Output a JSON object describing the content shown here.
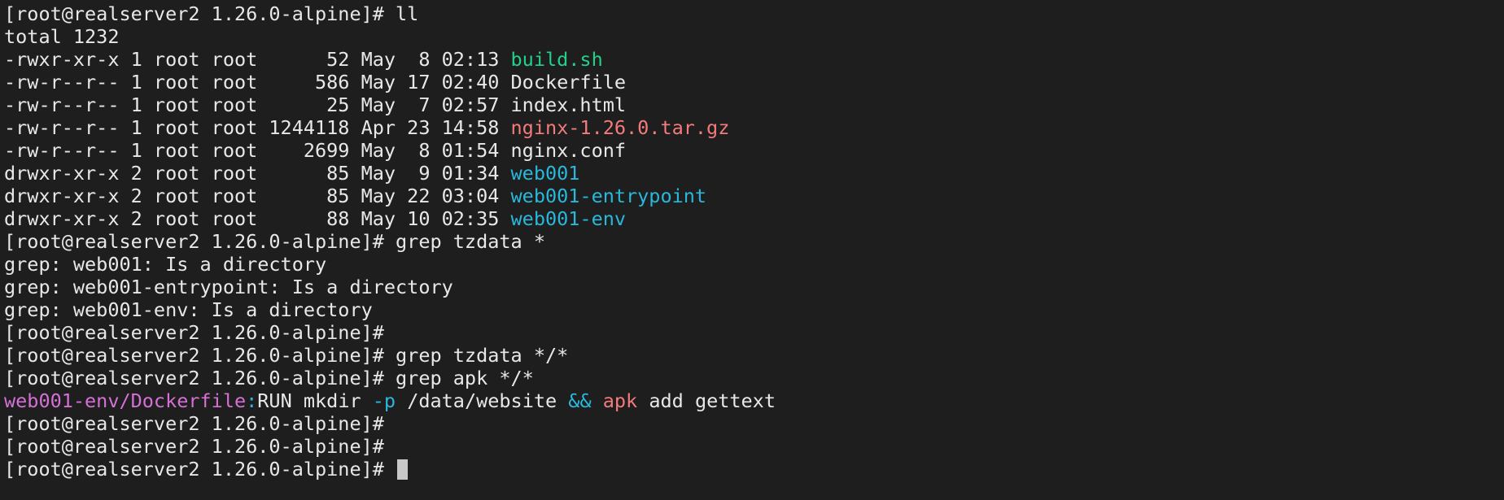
{
  "colors": {
    "background": "#1e1e1e",
    "default_text": "#e8e8e8",
    "executable": "#23d18b",
    "archive": "#f47b7b",
    "directory": "#29b8db",
    "grep_filename": "#d670d6",
    "grep_separator": "#29b8db",
    "highlight_operator": "#29b8db",
    "highlight_command": "#f47b7b"
  },
  "prompt": "[root@realserver2 1.26.0-alpine]#",
  "lines": [
    {
      "segments": [
        {
          "text": "[root@realserver2 1.26.0-alpine]# ll",
          "color": "default_text"
        }
      ]
    },
    {
      "segments": [
        {
          "text": "total 1232",
          "color": "default_text"
        }
      ]
    },
    {
      "segments": [
        {
          "text": "-rwxr-xr-x 1 root root      52 May  8 02:13 ",
          "color": "default_text"
        },
        {
          "text": "build.sh",
          "color": "executable"
        }
      ]
    },
    {
      "segments": [
        {
          "text": "-rw-r--r-- 1 root root     586 May 17 02:40 ",
          "color": "default_text"
        },
        {
          "text": "Dockerfile",
          "color": "default_text"
        }
      ]
    },
    {
      "segments": [
        {
          "text": "-rw-r--r-- 1 root root      25 May  7 02:57 ",
          "color": "default_text"
        },
        {
          "text": "index.html",
          "color": "default_text"
        }
      ]
    },
    {
      "segments": [
        {
          "text": "-rw-r--r-- 1 root root 1244118 Apr 23 14:58 ",
          "color": "default_text"
        },
        {
          "text": "nginx-1.26.0.tar.gz",
          "color": "archive"
        }
      ]
    },
    {
      "segments": [
        {
          "text": "-rw-r--r-- 1 root root    2699 May  8 01:54 ",
          "color": "default_text"
        },
        {
          "text": "nginx.conf",
          "color": "default_text"
        }
      ]
    },
    {
      "segments": [
        {
          "text": "drwxr-xr-x 2 root root      85 May  9 01:34 ",
          "color": "default_text"
        },
        {
          "text": "web001",
          "color": "directory"
        }
      ]
    },
    {
      "segments": [
        {
          "text": "drwxr-xr-x 2 root root      85 May 22 03:04 ",
          "color": "default_text"
        },
        {
          "text": "web001-entrypoint",
          "color": "directory"
        }
      ]
    },
    {
      "segments": [
        {
          "text": "drwxr-xr-x 2 root root      88 May 10 02:35 ",
          "color": "default_text"
        },
        {
          "text": "web001-env",
          "color": "directory"
        }
      ]
    },
    {
      "segments": [
        {
          "text": "[root@realserver2 1.26.0-alpine]# grep tzdata *",
          "color": "default_text"
        }
      ]
    },
    {
      "segments": [
        {
          "text": "grep: web001: Is a directory",
          "color": "default_text"
        }
      ]
    },
    {
      "segments": [
        {
          "text": "grep: web001-entrypoint: Is a directory",
          "color": "default_text"
        }
      ]
    },
    {
      "segments": [
        {
          "text": "grep: web001-env: Is a directory",
          "color": "default_text"
        }
      ]
    },
    {
      "segments": [
        {
          "text": "[root@realserver2 1.26.0-alpine]#",
          "color": "default_text"
        }
      ]
    },
    {
      "segments": [
        {
          "text": "[root@realserver2 1.26.0-alpine]# grep tzdata */*",
          "color": "default_text"
        }
      ]
    },
    {
      "segments": [
        {
          "text": "[root@realserver2 1.26.0-alpine]# grep apk */*",
          "color": "default_text"
        }
      ]
    },
    {
      "segments": [
        {
          "text": "web001-env/Dockerfile",
          "color": "grep_filename"
        },
        {
          "text": ":",
          "color": "grep_separator"
        },
        {
          "text": "RUN mkdir ",
          "color": "default_text"
        },
        {
          "text": "-p",
          "color": "highlight_operator"
        },
        {
          "text": " /data/website ",
          "color": "default_text"
        },
        {
          "text": "&&",
          "color": "highlight_operator"
        },
        {
          "text": " ",
          "color": "default_text"
        },
        {
          "text": "apk",
          "color": "highlight_command"
        },
        {
          "text": " add gettext",
          "color": "default_text"
        }
      ]
    },
    {
      "segments": [
        {
          "text": "[root@realserver2 1.26.0-alpine]#",
          "color": "default_text"
        }
      ]
    },
    {
      "segments": [
        {
          "text": "[root@realserver2 1.26.0-alpine]#",
          "color": "default_text"
        }
      ]
    },
    {
      "segments": [
        {
          "text": "[root@realserver2 1.26.0-alpine]# ",
          "color": "default_text"
        }
      ],
      "cursor": true
    }
  ]
}
